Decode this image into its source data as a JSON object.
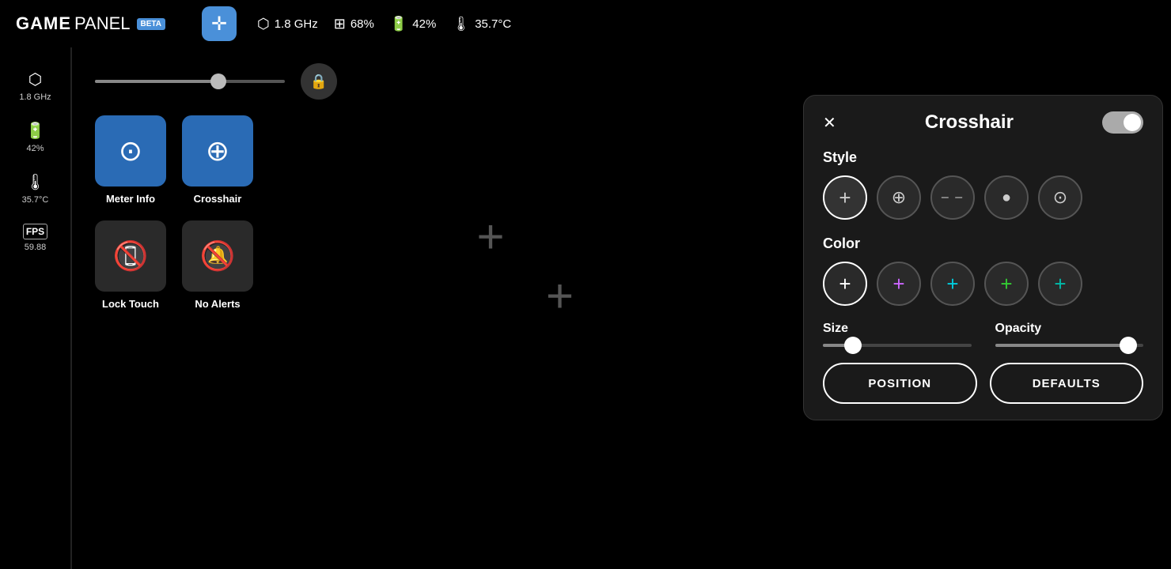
{
  "header": {
    "logo_game": "GAME",
    "logo_panel": "PANEL",
    "logo_beta": "BETA",
    "move_icon": "⊕",
    "cpu_icon": "⬡",
    "cpu_freq": "1.8 GHz",
    "gpu_icon": "⊞",
    "gpu_load": "68%",
    "battery_icon": "🔋",
    "battery_pct": "42%",
    "temp_icon": "🌡",
    "temp_val": "35.7°C"
  },
  "sidebar": {
    "items": [
      {
        "icon": "⬡",
        "label": "1.8 GHz"
      },
      {
        "icon": "🔋",
        "label": "42%"
      },
      {
        "icon": "🌡",
        "label": "35.7°C"
      },
      {
        "icon": "fps",
        "label": "59.88"
      }
    ]
  },
  "widgets": [
    {
      "id": "meter-info",
      "label": "Meter Info",
      "icon": "⊙",
      "theme": "blue",
      "active": true
    },
    {
      "id": "crosshair",
      "label": "Crosshair",
      "icon": "⊕",
      "theme": "blue",
      "active": true
    },
    {
      "id": "lock-touch",
      "label": "Lock Touch",
      "icon": "📱",
      "theme": "dark",
      "active": false
    },
    {
      "id": "no-alerts",
      "label": "No Alerts",
      "icon": "🔕",
      "theme": "dark",
      "active": false
    }
  ],
  "add_button_symbol": "+",
  "crosshair_panel": {
    "title": "Crosshair",
    "close_label": "✕",
    "toggle_on": true,
    "style_label": "Style",
    "style_options": [
      {
        "id": "style1",
        "symbol": "+",
        "selected": true
      },
      {
        "id": "style2",
        "symbol": "⊕",
        "selected": false
      },
      {
        "id": "style3",
        "symbol": "─ ─",
        "selected": false
      },
      {
        "id": "style4",
        "symbol": "•",
        "selected": false
      },
      {
        "id": "style5",
        "symbol": "⊙",
        "selected": false
      }
    ],
    "color_label": "Color",
    "color_options": [
      {
        "id": "white",
        "symbol": "+",
        "color_class": "color-white",
        "selected": true
      },
      {
        "id": "purple",
        "symbol": "+",
        "color_class": "color-purple",
        "selected": false
      },
      {
        "id": "cyan",
        "symbol": "+",
        "color_class": "color-cyan",
        "selected": false
      },
      {
        "id": "green",
        "symbol": "+",
        "color_class": "color-green",
        "selected": false
      },
      {
        "id": "teal",
        "symbol": "+",
        "color_class": "color-teal",
        "selected": false
      }
    ],
    "size_label": "Size",
    "size_value": 20,
    "opacity_label": "Opacity",
    "opacity_value": 90,
    "position_btn": "POSITION",
    "defaults_btn": "DEFAULTS"
  }
}
